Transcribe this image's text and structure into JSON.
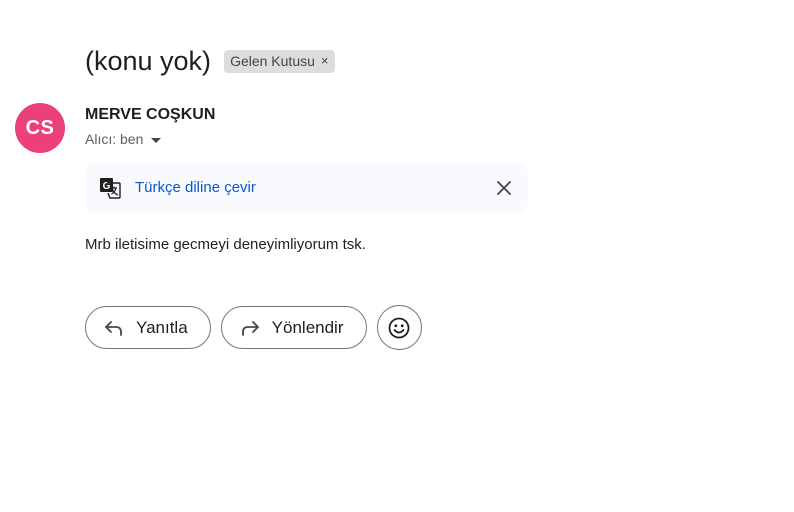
{
  "email": {
    "subject": "(konu yok)",
    "label_chip": "Gelen Kutusu",
    "label_chip_remove": "×",
    "sender_initials": "CS",
    "sender_name": "MERVE COŞKUN",
    "recipient_text": "Alıcı: ben",
    "avatar_color": "#ec407a",
    "body": "Mrb iletisime gecmeyi deneyimliyorum tsk."
  },
  "translate_bar": {
    "link_label": "Türkçe diline çevir",
    "icon": "translate-icon",
    "close_icon": "close-icon"
  },
  "actions": {
    "reply_label": "Yanıtla",
    "forward_label": "Yönlendir",
    "emoji_icon": "emoji-icon"
  },
  "colors": {
    "link_blue": "#0b57d0",
    "chip_bg": "#dddddd",
    "translate_bg": "#f8fafd"
  }
}
